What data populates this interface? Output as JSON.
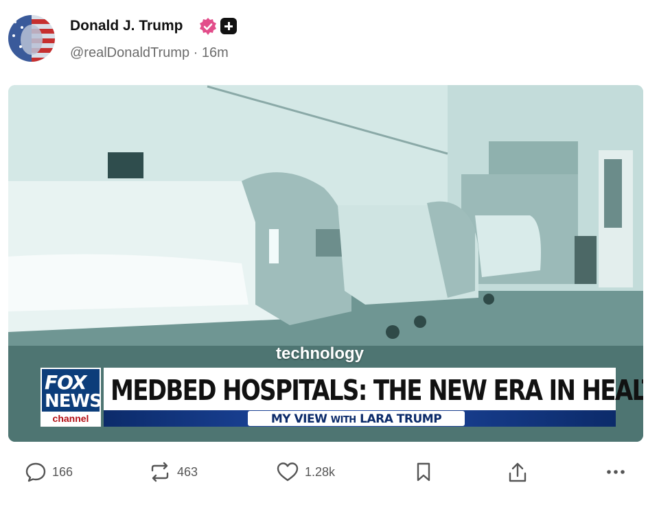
{
  "post": {
    "author_name": "Donald J. Trump",
    "handle": "@realDonaldTrump",
    "time": "16m",
    "handle_line": "@realDonaldTrump · 16m"
  },
  "media": {
    "overlay_label": "technology",
    "network_logo_line1": "FOX",
    "network_logo_line2": "NEWS",
    "network_logo_line3": "channel",
    "headline": "MEDBED HOSPITALS: THE NEW ERA IN HEALTHCARE",
    "show_title": "MY VIEW",
    "show_with": "WITH",
    "show_host": "LARA TRUMP"
  },
  "actions": {
    "replies": "166",
    "reposts": "463",
    "likes": "1.28k"
  },
  "icons": {
    "verified": "verified-badge-icon",
    "follow": "plus-icon",
    "reply": "comment-icon",
    "repost": "repost-icon",
    "like": "heart-icon",
    "bookmark": "bookmark-icon",
    "share": "share-icon",
    "more": "more-icon"
  },
  "colors": {
    "verified_badge": "#e24d8a",
    "fox_blue": "#0c3d7a",
    "fox_red": "#b20d12"
  }
}
